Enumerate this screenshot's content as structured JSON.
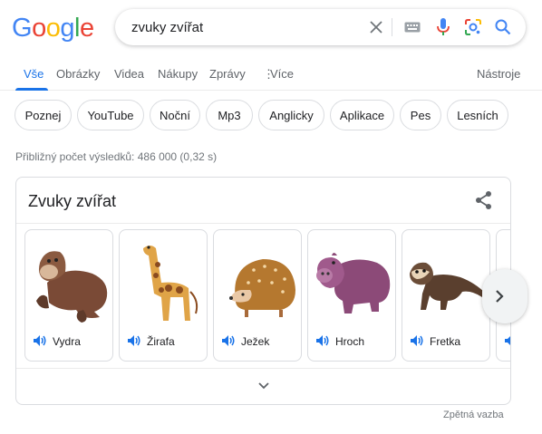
{
  "logo": {
    "letters": [
      {
        "ch": "G",
        "color": "#4285F4"
      },
      {
        "ch": "o",
        "color": "#EA4335"
      },
      {
        "ch": "o",
        "color": "#FBBC05"
      },
      {
        "ch": "g",
        "color": "#4285F4"
      },
      {
        "ch": "l",
        "color": "#34A853"
      },
      {
        "ch": "e",
        "color": "#EA4335"
      }
    ]
  },
  "search": {
    "query": "zvuky zvířat"
  },
  "tabs": [
    {
      "label": "Vše",
      "active": true
    },
    {
      "label": "Obrázky"
    },
    {
      "label": "Videa"
    },
    {
      "label": "Nákupy"
    },
    {
      "label": "Zprávy"
    },
    {
      "label": "Více"
    }
  ],
  "tools_label": "Nástroje",
  "chips": [
    "Poznej",
    "YouTube",
    "Noční",
    "Mp3",
    "Anglicky",
    "Aplikace",
    "Pes",
    "Lesních"
  ],
  "result_stats": "Přibližný počet výsledků: 486 000 (0,32 s)",
  "card": {
    "title": "Zvuky zvířat",
    "animals": [
      {
        "name": "Vydra"
      },
      {
        "name": "Žirafa"
      },
      {
        "name": "Ježek"
      },
      {
        "name": "Hroch"
      },
      {
        "name": "Fretka"
      }
    ]
  },
  "feedback": "Zpětná vazba",
  "colors": {
    "accent": "#1a73e8",
    "text": "#202124",
    "muted": "#70757a"
  }
}
